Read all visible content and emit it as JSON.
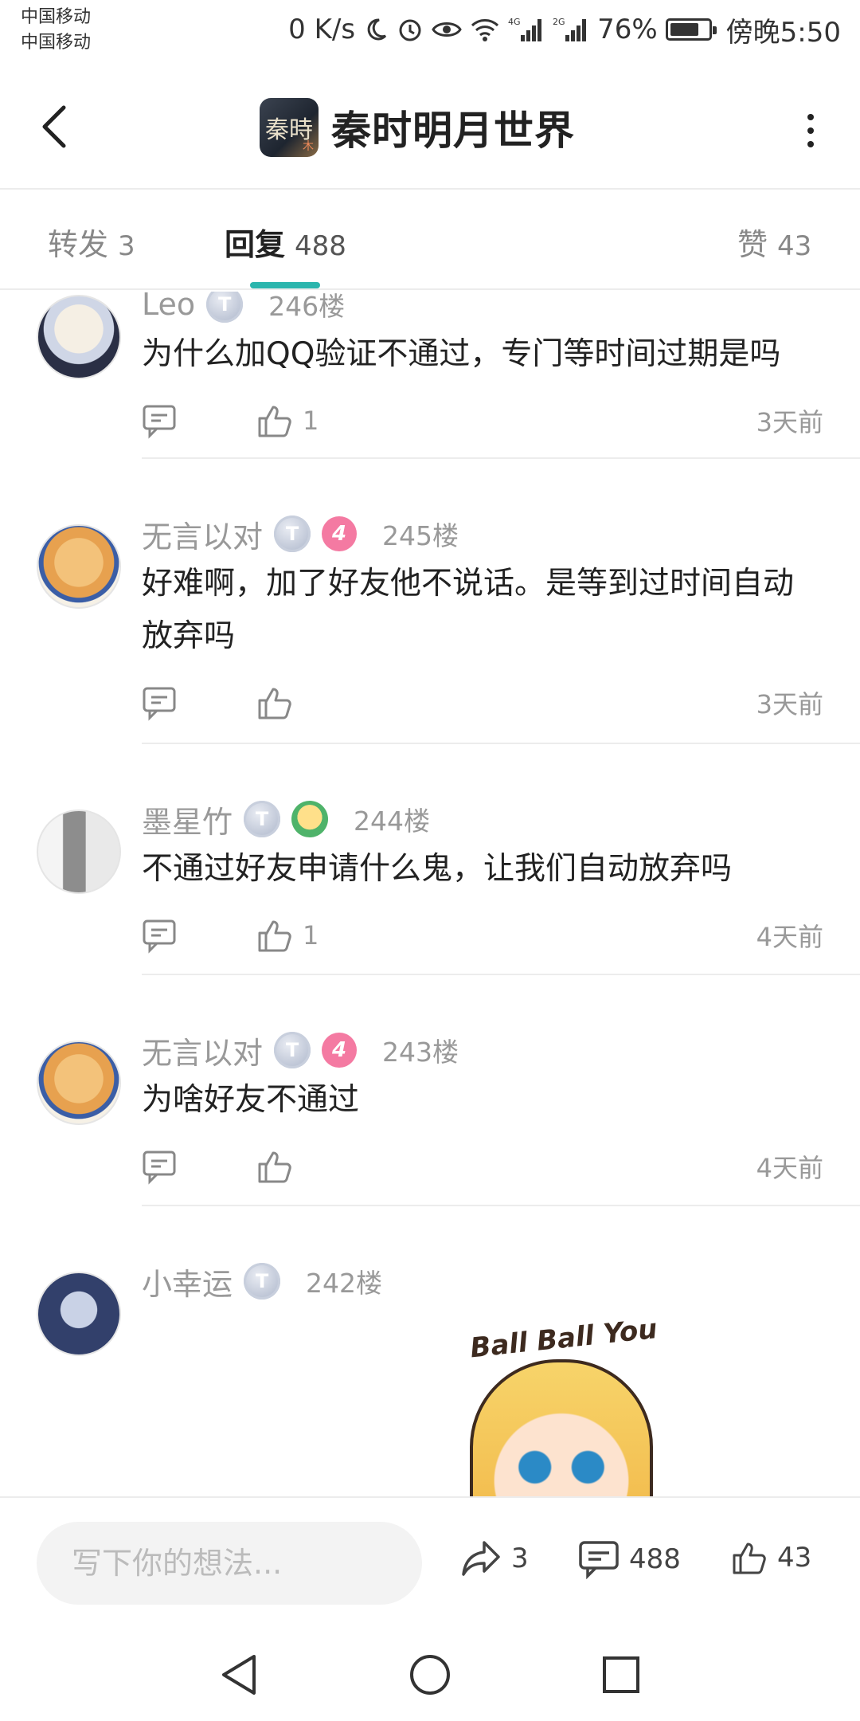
{
  "status_bar": {
    "carrier_1": "中国移动",
    "carrier_2": "中国移动",
    "net_speed": "0 K/s",
    "network_1": "4G",
    "network_2": "2G",
    "battery_percent": "76%",
    "battery_level": 0.76,
    "time": "傍晚5:50"
  },
  "header": {
    "title": "秦时明月世界",
    "logo_text": "秦時",
    "logo_sub": "木"
  },
  "tabs": [
    {
      "label": "转发",
      "count": "3"
    },
    {
      "label": "回复",
      "count": "488"
    },
    {
      "label": "赞",
      "count": "43"
    }
  ],
  "comments": [
    {
      "user": "Leo",
      "badge_t": "T",
      "level": "",
      "floor": "246楼",
      "text": "为什么加QQ验证不通过，专门等时间过期是吗",
      "likes": "1",
      "time": "3天前"
    },
    {
      "user": "无言以对",
      "badge_t": "T",
      "level": "4",
      "floor": "245楼",
      "text": "好难啊，加了好友他不说话。是等到过时间自动放弃吗",
      "likes": "",
      "time": "3天前"
    },
    {
      "user": "墨星竹",
      "badge_t": "T",
      "level": "",
      "floor": "244楼",
      "text": "不通过好友申请什么鬼，让我们自动放弃吗",
      "likes": "1",
      "time": "4天前"
    },
    {
      "user": "无言以对",
      "badge_t": "T",
      "level": "4",
      "floor": "243楼",
      "text": "为啥好友不通过",
      "likes": "",
      "time": "4天前"
    },
    {
      "user": "小幸运",
      "badge_t": "T",
      "level": "",
      "floor": "242楼",
      "sticker_text": "Ball Ball You"
    }
  ],
  "bottom_bar": {
    "input_placeholder": "写下你的想法...",
    "share_count": "3",
    "reply_count": "488",
    "like_count": "43"
  },
  "icons": {
    "back": "back-arrow-icon",
    "more": "more-vertical-icon",
    "reply": "comment-bubble-icon",
    "like": "thumb-up-icon",
    "share": "share-arrow-icon",
    "nav_back": "triangle-back-icon",
    "nav_home": "circle-home-icon",
    "nav_recent": "square-recent-icon"
  },
  "colors": {
    "accent": "#2bb5ad",
    "level_badge": "#f47aa2",
    "muted_text": "#999999"
  }
}
